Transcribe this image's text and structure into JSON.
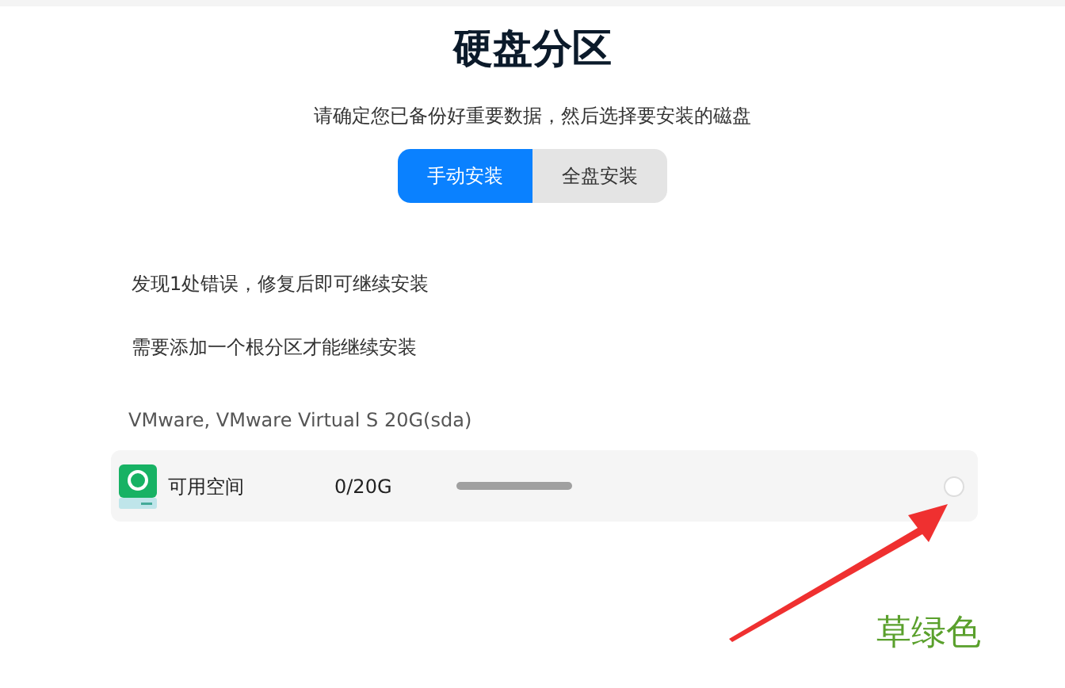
{
  "title": "硬盘分区",
  "subtitle": "请确定您已备份好重要数据，然后选择要安装的磁盘",
  "tabs": [
    {
      "label": "手动安装",
      "selected": true
    },
    {
      "label": "全盘安装",
      "selected": false
    }
  ],
  "messages": [
    "发现1处错误，修复后即可继续安装",
    "需要添加一个根分区才能继续安装"
  ],
  "disk": {
    "name": "VMware, VMware Virtual S 20G(sda)",
    "partitions": [
      {
        "label": "可用空间",
        "size": "0/20G"
      }
    ]
  },
  "annotation": {
    "text": "草绿色",
    "color": "#5aa02c"
  }
}
